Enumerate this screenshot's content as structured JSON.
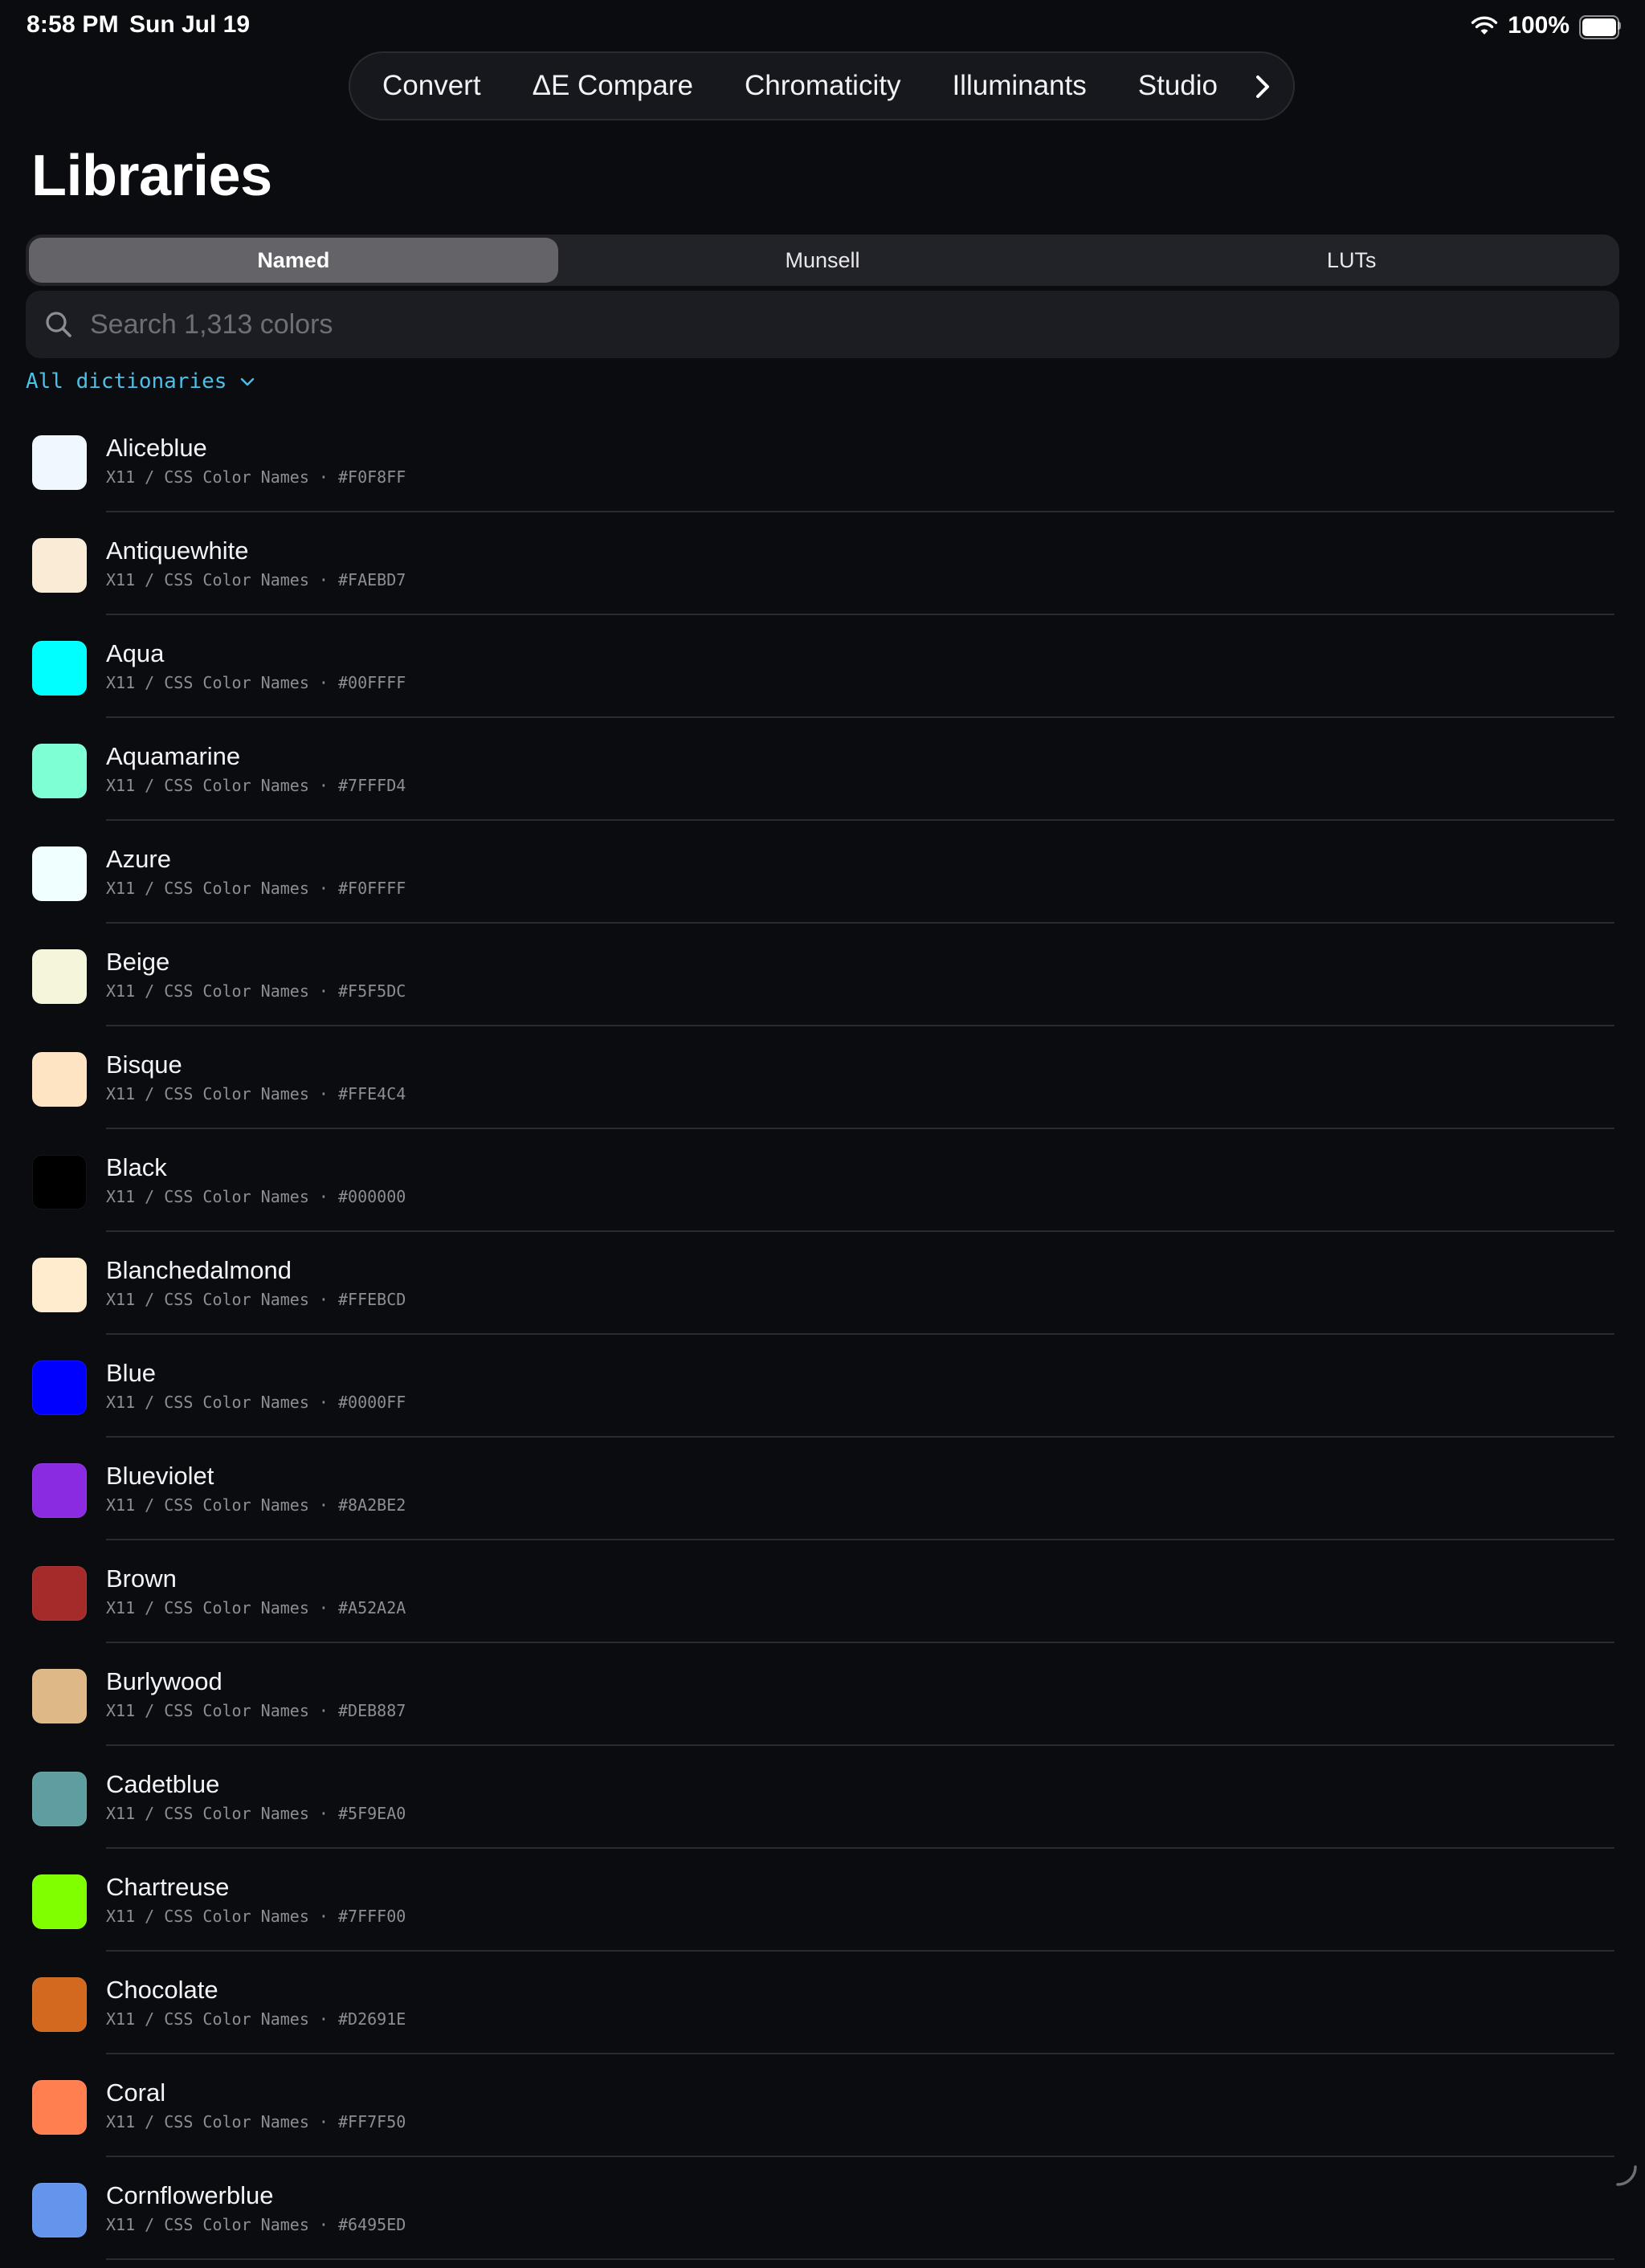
{
  "status_bar": {
    "time": "8:58 PM",
    "date": "Sun Jul 19",
    "battery": "100%"
  },
  "top_tabs": [
    {
      "label": "Convert"
    },
    {
      "label": "ΔE Compare"
    },
    {
      "label": "Chromaticity"
    },
    {
      "label": "Illuminants"
    },
    {
      "label": "Studio"
    }
  ],
  "page_title": "Libraries",
  "segments": [
    {
      "label": "Named",
      "selected": true
    },
    {
      "label": "Munsell",
      "selected": false
    },
    {
      "label": "LUTs",
      "selected": false
    }
  ],
  "search": {
    "placeholder": "Search 1,313 colors",
    "value": ""
  },
  "filter": {
    "label": "All dictionaries"
  },
  "colors": [
    {
      "name": "Aliceblue",
      "library": "X11 / CSS Color Names",
      "hex": "#F0F8FF"
    },
    {
      "name": "Antiquewhite",
      "library": "X11 / CSS Color Names",
      "hex": "#FAEBD7"
    },
    {
      "name": "Aqua",
      "library": "X11 / CSS Color Names",
      "hex": "#00FFFF"
    },
    {
      "name": "Aquamarine",
      "library": "X11 / CSS Color Names",
      "hex": "#7FFFD4"
    },
    {
      "name": "Azure",
      "library": "X11 / CSS Color Names",
      "hex": "#F0FFFF"
    },
    {
      "name": "Beige",
      "library": "X11 / CSS Color Names",
      "hex": "#F5F5DC"
    },
    {
      "name": "Bisque",
      "library": "X11 / CSS Color Names",
      "hex": "#FFE4C4"
    },
    {
      "name": "Black",
      "library": "X11 / CSS Color Names",
      "hex": "#000000"
    },
    {
      "name": "Blanchedalmond",
      "library": "X11 / CSS Color Names",
      "hex": "#FFEBCD"
    },
    {
      "name": "Blue",
      "library": "X11 / CSS Color Names",
      "hex": "#0000FF"
    },
    {
      "name": "Blueviolet",
      "library": "X11 / CSS Color Names",
      "hex": "#8A2BE2"
    },
    {
      "name": "Brown",
      "library": "X11 / CSS Color Names",
      "hex": "#A52A2A"
    },
    {
      "name": "Burlywood",
      "library": "X11 / CSS Color Names",
      "hex": "#DEB887"
    },
    {
      "name": "Cadetblue",
      "library": "X11 / CSS Color Names",
      "hex": "#5F9EA0"
    },
    {
      "name": "Chartreuse",
      "library": "X11 / CSS Color Names",
      "hex": "#7FFF00"
    },
    {
      "name": "Chocolate",
      "library": "X11 / CSS Color Names",
      "hex": "#D2691E"
    },
    {
      "name": "Coral",
      "library": "X11 / CSS Color Names",
      "hex": "#FF7F50"
    },
    {
      "name": "Cornflowerblue",
      "library": "X11 / CSS Color Names",
      "hex": "#6495ED"
    }
  ],
  "theme": {
    "background": "#0b0c10",
    "accent": "#4cc0e8",
    "segment_selected": "#636368"
  }
}
